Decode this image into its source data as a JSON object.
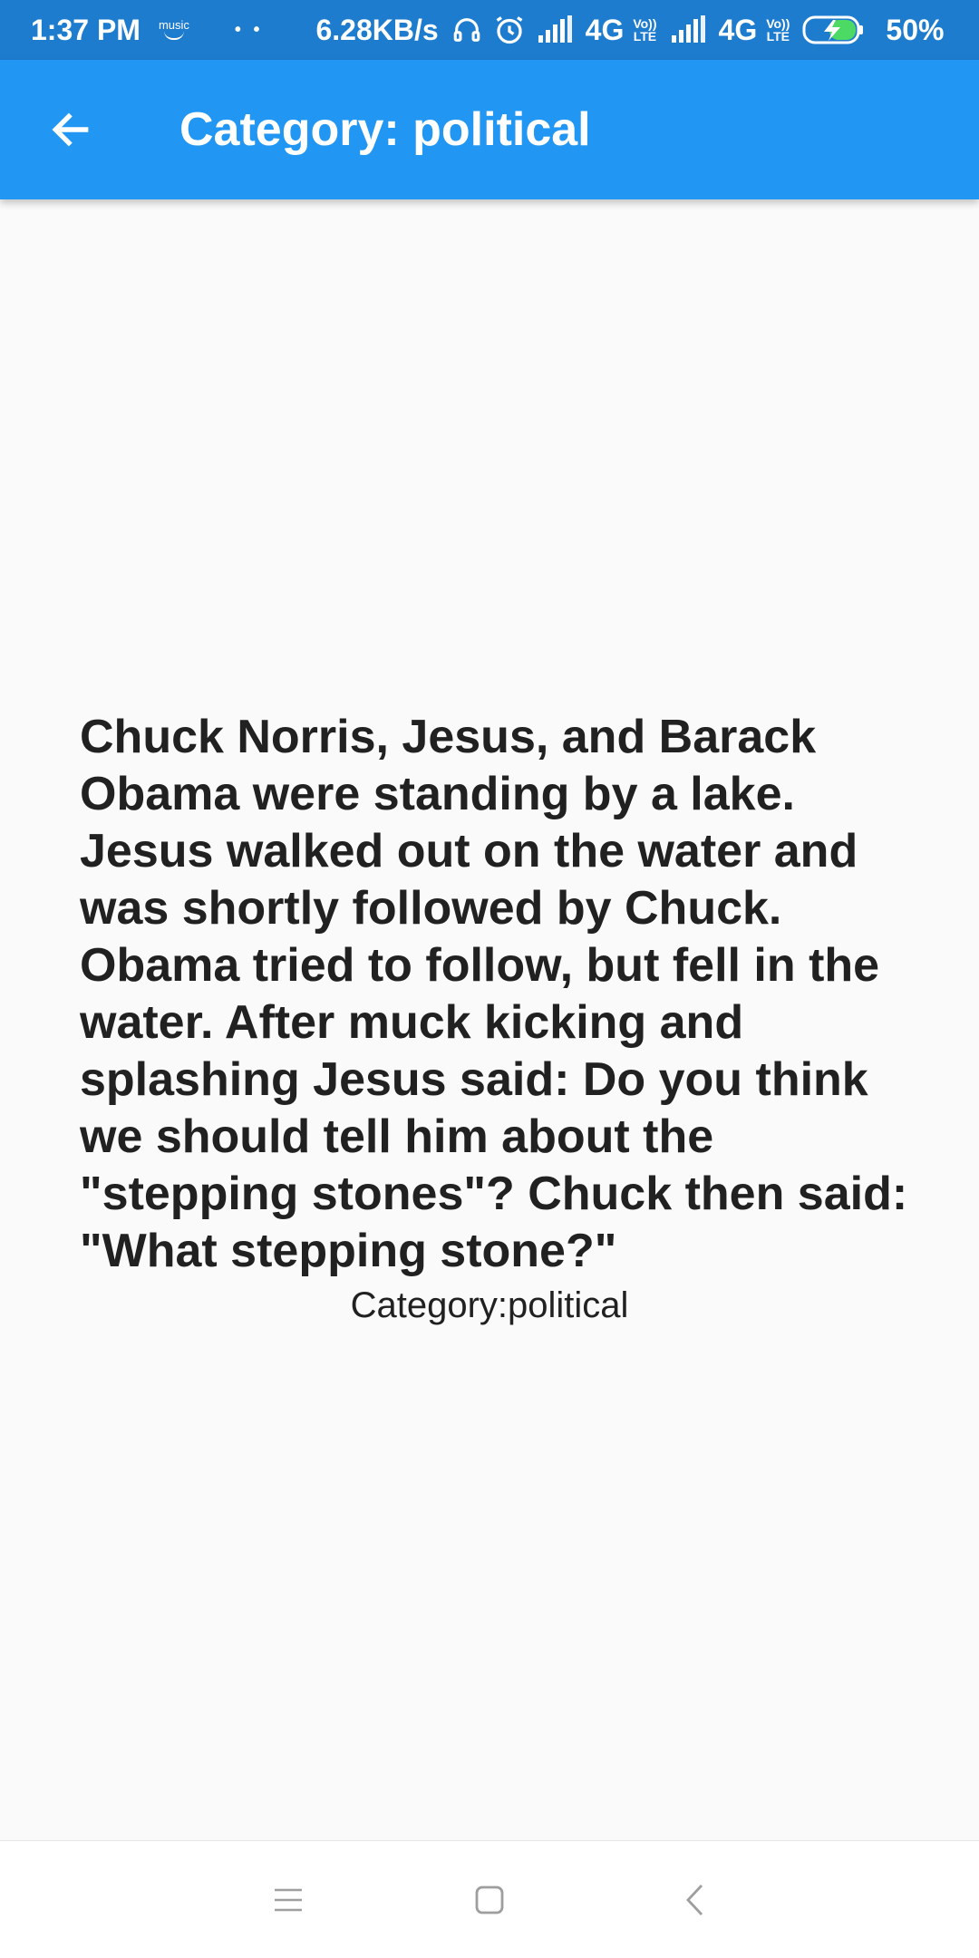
{
  "status_bar": {
    "time": "1:37 PM",
    "music_label": "music",
    "dots": "• •",
    "net_speed": "6.28KB/s",
    "network1": "4G",
    "volte1_top": "Vo))",
    "volte1_bottom": "LTE",
    "network2": "4G",
    "volte2_top": "Vo))",
    "volte2_bottom": "LTE",
    "battery_percent": "50%",
    "icons": [
      "amazon-music-icon",
      "headphones-icon",
      "alarm-icon",
      "signal-icon",
      "signal-icon",
      "battery-charging-icon"
    ]
  },
  "app_bar": {
    "title": "Category: political",
    "back_icon": "arrow-left-icon",
    "background": "#2196f3"
  },
  "joke": {
    "text": "Chuck Norris, Jesus, and Barack Obama were standing by a lake. Jesus walked out on the water and was shortly followed by Chuck. Obama tried to follow, but fell in the water. After muck kicking and splashing Jesus said: Do you think we should tell him about the \"stepping stones\"? Chuck then said: \"What stepping stone?\"",
    "category_line": "Category:political"
  },
  "nav_bar": {
    "icons": [
      "menu-icon",
      "home-square-icon",
      "back-chevron-icon"
    ]
  }
}
